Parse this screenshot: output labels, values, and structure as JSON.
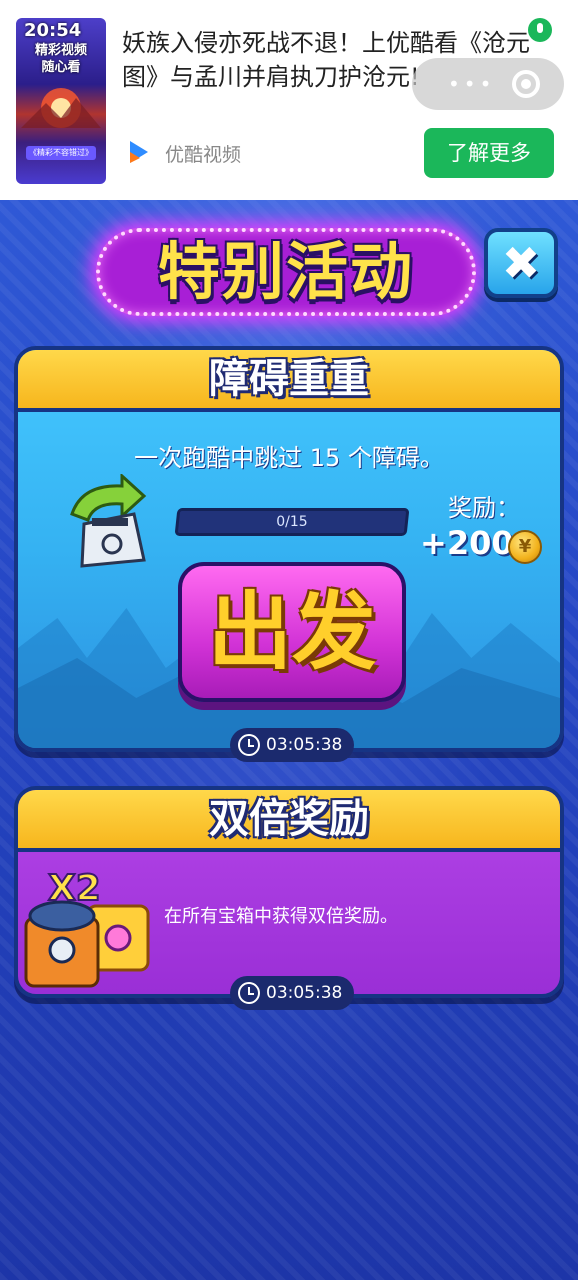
{
  "ad": {
    "status_time": "20:54",
    "thumb_text": "精彩视频\n随心看",
    "thumb_banner": "《精彩不容错过》",
    "title": "妖族入侵亦死战不退！上优酷看《沧元图》与孟川并肩执刀护沧元!",
    "source": "优酷视频",
    "cta": "了解更多"
  },
  "header": {
    "title": "特别活动"
  },
  "close_icon": "close-icon",
  "event1": {
    "title": "障碍重重",
    "description": "一次跑酷中跳过 15 个障碍。",
    "progress_text": "0/15",
    "progress_fraction": 0,
    "reward_label": "奖励：",
    "reward_value": "+200",
    "go_label": "出发",
    "timer": "03:05:38"
  },
  "event2": {
    "title": "双倍奖励",
    "multiplier": "X2",
    "description": "在所有宝箱中获得双倍奖励。",
    "timer": "03:05:38"
  },
  "colors": {
    "accent_yellow": "#ffd84a",
    "card_blue": "#45c8ff",
    "card_purple": "#b445e8",
    "go_pink": "#d132d6",
    "cta_green": "#1bb75a"
  }
}
